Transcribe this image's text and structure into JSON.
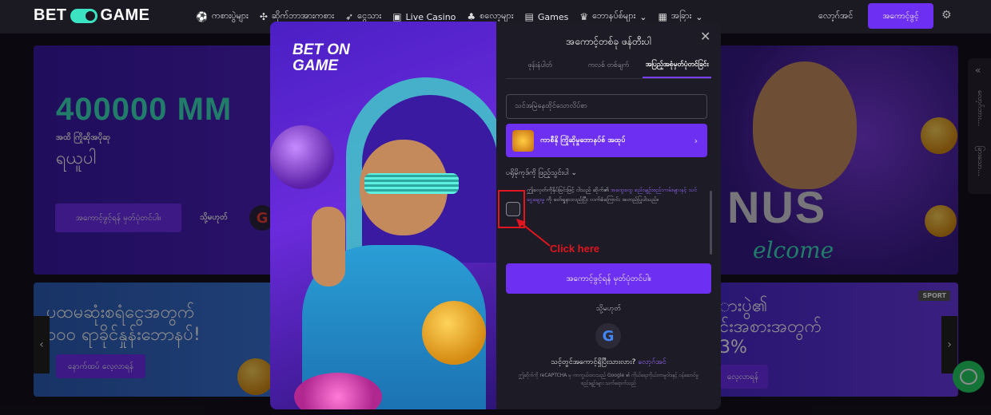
{
  "brand": {
    "logo_text_left": "BET",
    "logo_text_right": "GAME",
    "accent": "#6d2ff2",
    "teal": "#3ce3c2"
  },
  "nav": {
    "items": [
      {
        "label": "ကစားပွဲများ",
        "icon": "soccer-ball-icon"
      },
      {
        "label": "ဆိုက်ဘာအားကစား",
        "icon": "gamepad-icon"
      },
      {
        "label": "ငွေသား",
        "icon": "rocket-icon"
      },
      {
        "label": "Live Casino",
        "icon": "cards-icon"
      },
      {
        "label": "စလော့များ",
        "icon": "slots-icon"
      },
      {
        "label": "Games",
        "icon": "games-icon"
      },
      {
        "label": "ဘောနပ်စ်များ",
        "icon": "crown-icon"
      },
      {
        "label": "အခြား",
        "icon": "grid-icon"
      }
    ],
    "login": "လော့ဂ်အင်",
    "register": "အကောင့်ဖွင့်"
  },
  "hero": {
    "amount": "400000 MM",
    "sub1": "အထိ ကြိုဆိုအပိုဆု",
    "sub2": "ရယူပါ",
    "button": "အကောင့်ဖွင့်ရန် မှတ်ပုံတင်ပါ။",
    "or": "သို့မဟုတ်",
    "right_text": "NUS",
    "welcome_text": "elcome"
  },
  "promos": {
    "left_text_1": "ပထမဆုံးစရံငွေအတွက်",
    "left_text_2": "၁၀၀ ရာခိုင်နှုန်းဘောနပ်!",
    "left_button": "နောက်ထပ် လေ့လာရန်",
    "right_text_1": "ားပွဲ၏",
    "right_text_2": "င်းအစားအတွက်",
    "right_text_3": "3%",
    "right_button": "လေ့လာရန်",
    "sport_badge": "SPORT"
  },
  "side_tab": {
    "label_1": "လော့ဂ်ဘား...",
    "label_2": "ခြားသော..."
  },
  "modal": {
    "logo_line1": "BET ON",
    "logo_line2": "GAME",
    "title": "အကောင့်တစ်ခု ဖန်တီးပါ",
    "tabs": [
      "ဖုန်းနံပါတ်",
      "ကလစ် တစ်ချက်",
      "အပြည့်အစုံမှတ်ပုံတင်ခြင်း"
    ],
    "active_tab": 2,
    "field_placeholder": "သင်အမြဲနေထိုင်သောလိပ်စာ",
    "bonus_label": "ကာစီနို ကြိုဆိုမှုဘောနပ်စ် အထုပ်",
    "promo_code": "ပရိုမိုကုဒ်ကို ဖြည့်သွင်းပါ",
    "terms_text_1": "ဤခလုတ်ကိုနှိပ်ခြင်းဖြင့် ငါသည် ဆိုက်၏ ",
    "terms_link": "အထွေထွေ စည်းမျဉ်းစည်းကမ်းများနှင့် သင်ငွေချေးမှု",
    "terms_text_2": " ကို ဖတ်ရှုနားလည်ပြီး လက်ခံကြောင်း အတည်ပြုပါသည်။",
    "submit": "အကောင့်ဖွင့်ရန် မှတ်ပုံတင်ပါ။",
    "or": "သို့မဟုတ်",
    "have_account": "သင့်တွင်အကောင့်ရှိပြီးသားလား?",
    "login_link": "လော့ဂ်အင်",
    "recaptcha": "ဤဆိုက်ကို reCAPTCHA မှ ကာကွယ်ထားသည် Google ၏ ကိုယ်ရေးကိုယ်တာမူဝါဒနှင့် ဝန်ဆောင်မှုစည်းမျဉ်းများ သက်ရောက်သည်"
  },
  "annotation": {
    "click_here": "Click here",
    "color": "#e0151f"
  }
}
